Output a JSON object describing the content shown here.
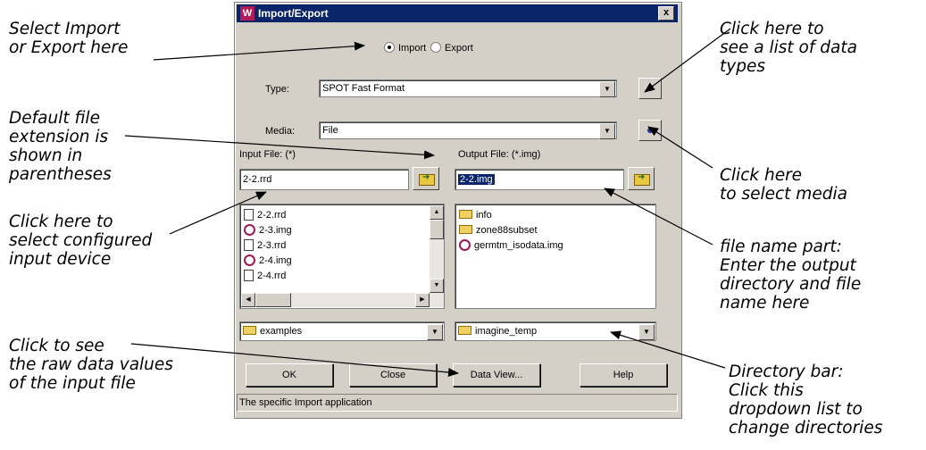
{
  "annotations": {
    "import_export": "Select Import\nor Export here",
    "extension": "Default file\nextension is\nshown in\nparentheses",
    "input_device": "Click here to\nselect configured\ninput device",
    "raw_data": "Click to see\nthe raw data values\nof the input file",
    "data_types": "Click here to\nsee a list of data\ntypes",
    "media": "Click here\nto select media",
    "file_name": "file name part:\nEnter the output\ndirectory and file\nname here",
    "directory_bar": "Directory bar:\nClick this\ndropdown list to\nchange directories"
  },
  "dialog": {
    "title": "Import/Export",
    "close_glyph": "x",
    "app_icon_letter": "W",
    "mode": {
      "import_label": "Import",
      "export_label": "Export",
      "selected": "Import"
    },
    "type_label": "Type:",
    "type_value": "SPOT Fast Format",
    "media_label": "Media:",
    "media_value": "File",
    "input_label": "Input File: (*)",
    "output_label": "Output File: (*.img)",
    "input_value": "2-2.rrd",
    "output_value": "2-2.img",
    "input_files": [
      {
        "name": "2-2.rrd",
        "icon": "document"
      },
      {
        "name": "2-3.img",
        "icon": "image"
      },
      {
        "name": "2-3.rrd",
        "icon": "document"
      },
      {
        "name": "2-4.img",
        "icon": "image"
      },
      {
        "name": "2-4.rrd",
        "icon": "document"
      }
    ],
    "output_files": [
      {
        "name": "info",
        "icon": "folder"
      },
      {
        "name": "zone88subset",
        "icon": "folder"
      },
      {
        "name": "germtm_isodata.img",
        "icon": "image"
      }
    ],
    "input_dir": "examples",
    "output_dir": "imagine_temp",
    "buttons": {
      "ok": "OK",
      "close": "Close",
      "data_view": "Data View...",
      "help": "Help"
    },
    "status": "The specific Import application"
  }
}
